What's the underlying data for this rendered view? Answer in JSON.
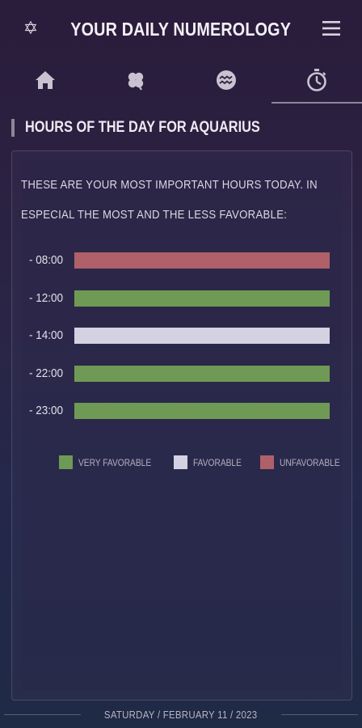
{
  "header": {
    "title": "YOUR DAILY NUMEROLOGY",
    "left_icon": "star-of-david-icon",
    "right_icon": "hamburger-menu-icon"
  },
  "tabs": [
    {
      "icon": "home-icon",
      "active": false
    },
    {
      "icon": "clover-icon",
      "active": false
    },
    {
      "icon": "aquarius-icon",
      "active": false
    },
    {
      "icon": "stopwatch-icon",
      "active": true
    }
  ],
  "section": {
    "title": "HOURS OF THE DAY FOR AQUARIUS"
  },
  "intro": {
    "line1": "THESE ARE YOUR MOST IMPORTANT HOURS TODAY. IN",
    "line2": "ESPECIAL THE MOST AND THE LESS FAVORABLE:"
  },
  "hours": [
    {
      "label": "- 08:00",
      "rating": "unfavorable"
    },
    {
      "label": "- 12:00",
      "rating": "very_favorable"
    },
    {
      "label": "- 14:00",
      "rating": "favorable"
    },
    {
      "label": "- 22:00",
      "rating": "very_favorable"
    },
    {
      "label": "- 23:00",
      "rating": "very_favorable"
    }
  ],
  "legend": {
    "very_favorable": "VERY FAVORABLE",
    "favorable": "FAVORABLE",
    "unfavorable": "UNFAVORABLE"
  },
  "colors": {
    "very_favorable": "#6e9a55",
    "favorable": "#d4d2e2",
    "unfavorable": "#b06068",
    "accent": "#8e869b"
  },
  "footer": {
    "date": "SATURDAY / FEBRUARY 11 / 2023"
  }
}
